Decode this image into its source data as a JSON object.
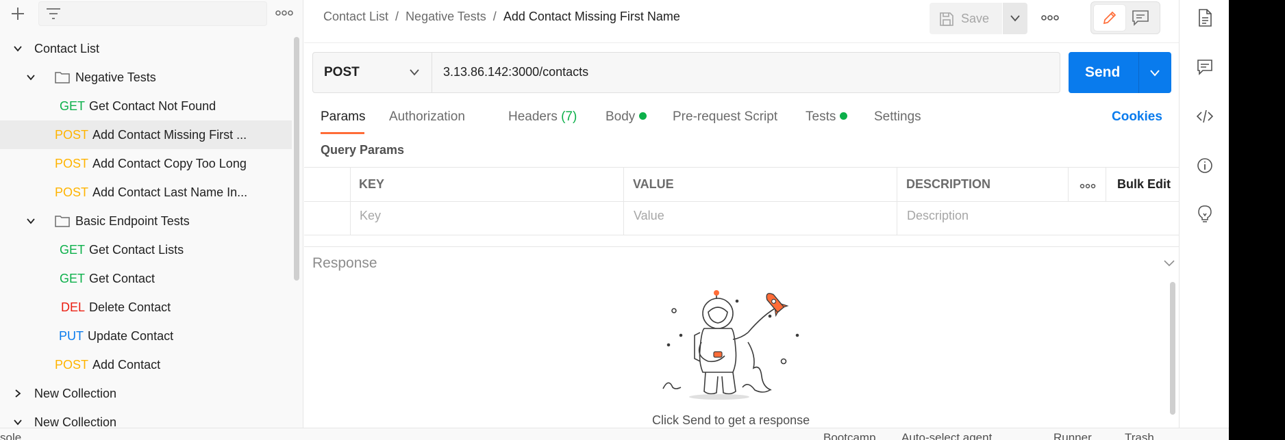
{
  "sidebar": {
    "more_label": "ooo",
    "items": [
      {
        "type": "collection",
        "label": "Contact List",
        "expanded": true
      },
      {
        "type": "folder",
        "label": "Negative Tests",
        "expanded": true
      },
      {
        "type": "request",
        "method": "GET",
        "label": "Get Contact Not Found"
      },
      {
        "type": "request",
        "method": "POST",
        "label": "Add Contact Missing First ...",
        "selected": true
      },
      {
        "type": "request",
        "method": "POST",
        "label": "Add Contact Copy Too Long"
      },
      {
        "type": "request",
        "method": "POST",
        "label": "Add Contact Last Name In..."
      },
      {
        "type": "folder",
        "label": "Basic Endpoint Tests",
        "expanded": true
      },
      {
        "type": "request",
        "method": "GET",
        "label": "Get Contact Lists"
      },
      {
        "type": "request",
        "method": "GET",
        "label": "Get Contact"
      },
      {
        "type": "request",
        "method": "DEL",
        "label": "Delete Contact"
      },
      {
        "type": "request",
        "method": "PUT",
        "label": "Update Contact"
      },
      {
        "type": "request",
        "method": "POST",
        "label": "Add Contact"
      },
      {
        "type": "collection",
        "label": "New Collection",
        "expanded": false
      },
      {
        "type": "collection",
        "label": "New Collection",
        "expanded": true
      }
    ]
  },
  "breadcrumb": {
    "parts": [
      "Contact List",
      "Negative Tests"
    ],
    "current": "Add Contact Missing First Name",
    "separator": "/"
  },
  "toolbar": {
    "save_label": "Save"
  },
  "request": {
    "method": "POST",
    "url": "3.13.86.142:3000/contacts",
    "send_label": "Send"
  },
  "tabs": {
    "params": "Params",
    "authorization": "Authorization",
    "headers": "Headers",
    "headers_count": "(7)",
    "body": "Body",
    "prerequest": "Pre-request Script",
    "tests": "Tests",
    "settings": "Settings",
    "cookies": "Cookies"
  },
  "query_params": {
    "title": "Query Params",
    "columns": [
      "KEY",
      "VALUE",
      "DESCRIPTION"
    ],
    "bulk_edit": "Bulk Edit",
    "placeholders": [
      "Key",
      "Value",
      "Description"
    ]
  },
  "response": {
    "title": "Response",
    "empty_message": "Click Send to get a response"
  },
  "status_bar": {
    "left": "sole",
    "items": [
      "Bootcamp",
      "Auto-select agent",
      "Runner",
      "Trash"
    ]
  },
  "colors": {
    "get": "#0cb04a",
    "post": "#ffb400",
    "del": "#eb2013",
    "put": "#097bed",
    "send": "#097bed",
    "active_tab": "#ff6c37"
  }
}
